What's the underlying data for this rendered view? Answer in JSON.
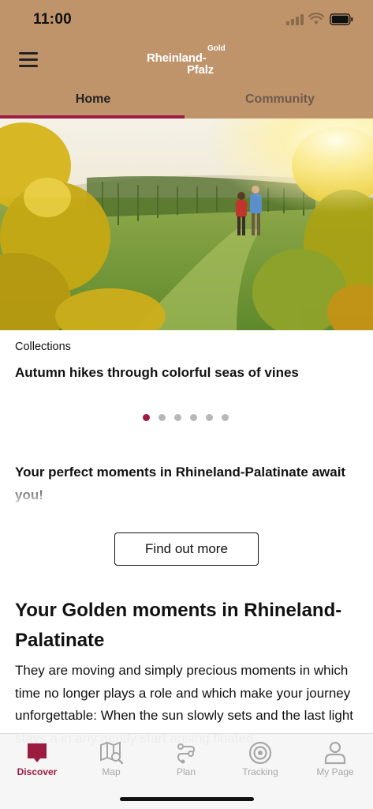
{
  "status_bar": {
    "time": "11:00"
  },
  "header": {
    "logo": {
      "gold": "Gold",
      "line1": "Rheinland-",
      "line2": "Pfalz"
    },
    "menu_icon": "hamburger-menu-icon"
  },
  "tabs": [
    {
      "label": "Home",
      "active": true
    },
    {
      "label": "Community",
      "active": false
    }
  ],
  "carousel": {
    "category": "Collections",
    "title": "Autumn hikes through colorful seas of vines",
    "page_count": 6,
    "active_index": 0
  },
  "promo": {
    "text": "Your perfect moments in Rhineland-Palatinate await you!",
    "button_label": "Find out more"
  },
  "section": {
    "title": "Your Golden moments in Rhineland-Palatinate",
    "body": "They are moving and simply precious moments in which time no longer plays a role and which make your journey unforgettable: When the sun slowly sets and the last light stays a in any gently start ansing floated"
  },
  "bottom_nav": [
    {
      "label": "Discover",
      "icon": "discover-icon",
      "active": true
    },
    {
      "label": "Map",
      "icon": "map-icon",
      "active": false
    },
    {
      "label": "Plan",
      "icon": "route-plan-icon",
      "active": false
    },
    {
      "label": "Tracking",
      "icon": "tracking-target-icon",
      "active": false
    },
    {
      "label": "My Page",
      "icon": "user-icon",
      "active": false
    }
  ],
  "colors": {
    "header_bg": "#c0946b",
    "accent": "#9b1b41",
    "inactive_nav": "#a7a7a7"
  }
}
